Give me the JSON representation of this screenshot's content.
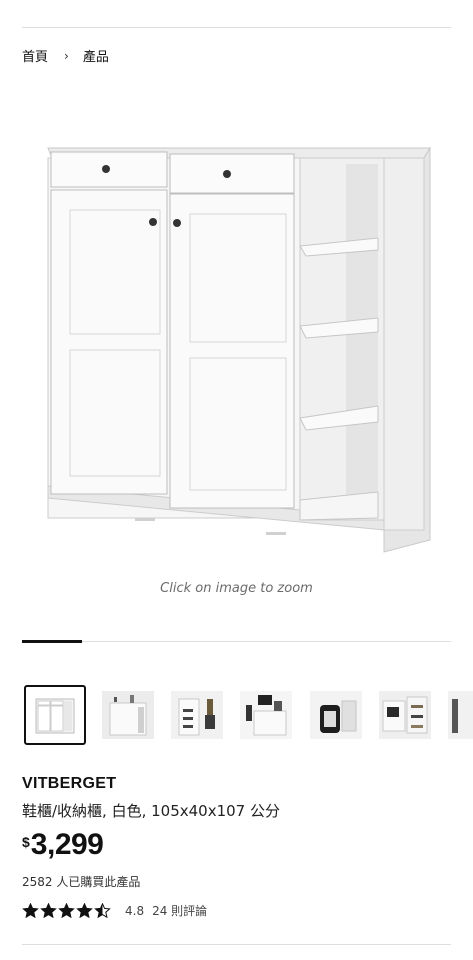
{
  "breadcrumb": {
    "home": "首頁",
    "separator": "›",
    "current": "產品"
  },
  "hero": {
    "zoom_hint": "Click on image to zoom"
  },
  "gallery": {
    "progress_fraction": 0.14,
    "thumbnail_count": 7,
    "selected_index": 0
  },
  "product": {
    "name": "VITBERGET",
    "description": "鞋櫃/收納櫃, 白色, 105x40x107 公分",
    "currency": "$",
    "price": "3,299",
    "purchases": "2582 人已購買此產品",
    "rating": 4.5,
    "rating_label": "4.8",
    "reviews": "24 則評論"
  },
  "colors": {
    "text": "#111111",
    "divider": "#dfdfdf",
    "cabinet": "#f4f4f4",
    "star": "#111111"
  }
}
